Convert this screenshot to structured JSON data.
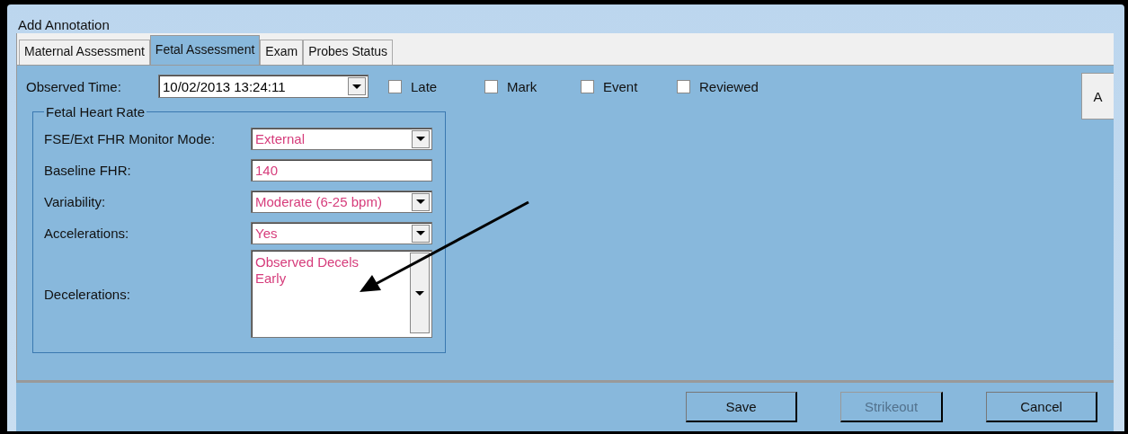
{
  "window": {
    "title": "Add Annotation"
  },
  "tabs": [
    {
      "label": "Maternal Assessment",
      "selected": false
    },
    {
      "label": "Fetal Assessment",
      "selected": true
    },
    {
      "label": "Exam",
      "selected": false
    },
    {
      "label": "Probes Status",
      "selected": false
    }
  ],
  "side_tab": {
    "label": "A"
  },
  "observed_time": {
    "label": "Observed Time:",
    "value": "10/02/2013 13:24:11"
  },
  "flags": [
    {
      "label": "Late",
      "checked": false
    },
    {
      "label": "Mark",
      "checked": false
    },
    {
      "label": "Event",
      "checked": false
    },
    {
      "label": "Reviewed",
      "checked": false
    }
  ],
  "group": {
    "title": "Fetal Heart Rate",
    "fields": [
      {
        "kind": "dropdown",
        "label": "FSE/Ext FHR Monitor Mode:",
        "value": "External"
      },
      {
        "kind": "text",
        "label": "Baseline FHR:",
        "value": "140"
      },
      {
        "kind": "dropdown",
        "label": "Variability:",
        "value": "Moderate (6-25 bpm)"
      },
      {
        "kind": "dropdown",
        "label": "Accelerations:",
        "value": "Yes"
      },
      {
        "kind": "list",
        "label": "Decelerations:",
        "lines": [
          "Observed Decels",
          "Early"
        ]
      }
    ]
  },
  "buttons": [
    {
      "label": "Save",
      "disabled": false
    },
    {
      "label": "Strikeout",
      "disabled": true
    },
    {
      "label": "Cancel",
      "disabled": false
    }
  ]
}
